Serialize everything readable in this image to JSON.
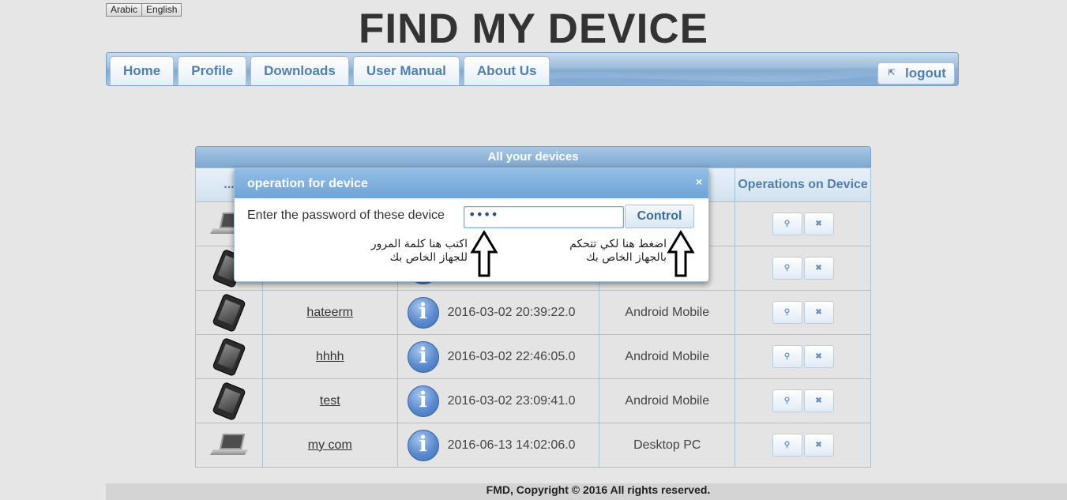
{
  "languages": [
    "Arabic",
    "English"
  ],
  "site_title": "FIND MY DEVICE",
  "nav": {
    "tabs": [
      "Home",
      "Profile",
      "Downloads",
      "User Manual",
      "About Us"
    ],
    "logout_label": "logout",
    "logout_icon": "external-link-icon"
  },
  "devices": {
    "caption": "All your devices",
    "headers": [
      "...",
      "",
      "",
      "",
      "Operations on Device"
    ],
    "rows": [
      {
        "type": "laptop",
        "name": "",
        "date": "",
        "kind": ""
      },
      {
        "type": "phone",
        "name": "",
        "date": "",
        "kind": ""
      },
      {
        "type": "phone",
        "name": "hateerm",
        "date": "2016-03-02 20:39:22.0",
        "kind": "Android Mobile"
      },
      {
        "type": "phone",
        "name": "hhhh",
        "date": "2016-03-02 22:46:05.0",
        "kind": "Android Mobile"
      },
      {
        "type": "phone",
        "name": "test",
        "date": "2016-03-02 23:09:41.0",
        "kind": "Android Mobile"
      },
      {
        "type": "laptop",
        "name": "my com",
        "date": "2016-06-13 14:02:06.0",
        "kind": "Desktop PC"
      }
    ],
    "op_icons": [
      "search-icon",
      "delete-icon"
    ]
  },
  "modal": {
    "title": "operation for device",
    "close": "×",
    "label": "Enter the password of these device",
    "password_value": "••••",
    "control_label": "Control",
    "hint_password": "اكتب هنا كلمة المرور للجهاز الخاص بك",
    "hint_control": "اضغط هنا لكي تتحكم بالجهاز الخاص بك"
  },
  "footer": "FMD, Copyright © 2016 All rights reserved.",
  "colors": {
    "accent": "#4f7fae",
    "nav_bg": "#9bbcdb",
    "modal_head": "#6ea4d8",
    "background": "#e6e6e6"
  }
}
